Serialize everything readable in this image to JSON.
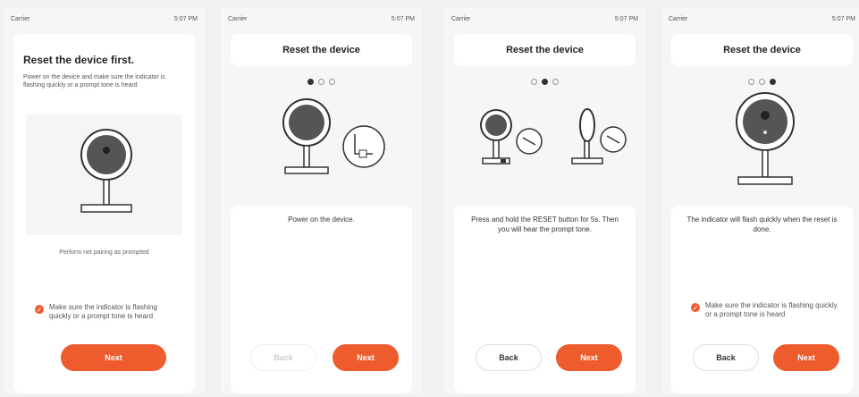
{
  "status_bar": {
    "left": "Carrier",
    "right": "5:07 PM"
  },
  "screens": [
    {
      "title": "Reset the device first.",
      "description": "Power on the device and make sure the indicator is flashing quickly or a prompt tone is heard",
      "image_caption": "Perform net pairing as prompted",
      "checkbox_text": "Make sure the indicator is flashing quickly or a prompt tone is heard",
      "next_label": "Next"
    },
    {
      "title": "Reset the device",
      "caption": "Power on the device.",
      "back_label": "Back",
      "next_label": "Next"
    },
    {
      "title": "Reset the device",
      "caption": "Press and hold the RESET button for 5s. Then you will hear the prompt tone.",
      "back_label": "Back",
      "next_label": "Next"
    },
    {
      "title": "Reset the device",
      "caption": "The indicator will flash quickly when the reset is done.",
      "checkbox_text": "Make sure the indicator is flashing quickly or a prompt tone is heard",
      "back_label": "Back",
      "next_label": "Next"
    }
  ],
  "colors": {
    "accent": "#ee5b2c"
  }
}
